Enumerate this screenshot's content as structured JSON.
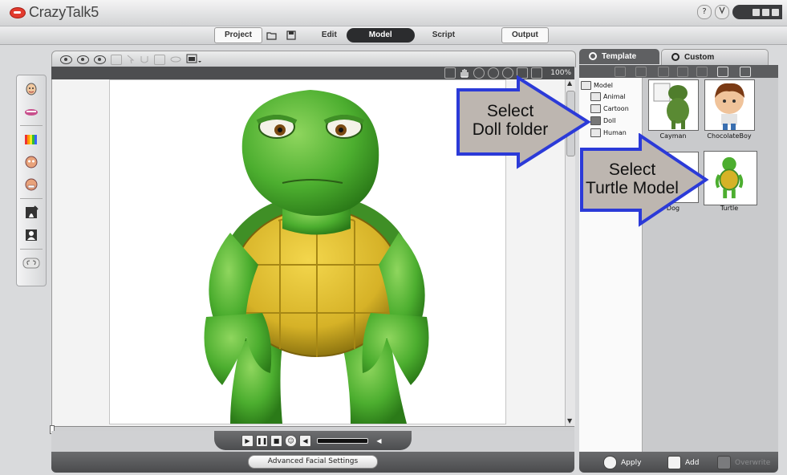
{
  "app": {
    "title": "CrazyTalk5",
    "help_label": "?"
  },
  "modes": {
    "project": "Project",
    "edit": "Edit",
    "model": "Model",
    "script": "Script",
    "output": "Output"
  },
  "stage": {
    "zoom": "100%",
    "bottom_button": "Advanced Facial Settings"
  },
  "library": {
    "tabs": [
      {
        "label": "Template",
        "active": true
      },
      {
        "label": "Custom",
        "active": false
      }
    ],
    "tree": {
      "root": "Model",
      "folders": [
        "Animal",
        "Cartoon",
        "Doll",
        "Human"
      ],
      "selected": "Doll"
    },
    "items": [
      {
        "name": "Cayman"
      },
      {
        "name": "ChocolateBoy"
      },
      {
        "name": "Dog"
      },
      {
        "name": "Turtle"
      }
    ],
    "actions": {
      "apply": "Apply",
      "add": "Add",
      "overwrite": "Overwrite"
    }
  },
  "callouts": {
    "select_doll": [
      "Select",
      "Doll folder"
    ],
    "select_turtle": [
      "Select",
      "Turtle Model"
    ]
  },
  "colors": {
    "callout_fill": "#bdb6b0",
    "callout_stroke": "#2b3ad8",
    "active_mode_bg": "#2b2c2e",
    "turtle_skin": "#4cae2f",
    "turtle_shell": "#d6b227"
  }
}
